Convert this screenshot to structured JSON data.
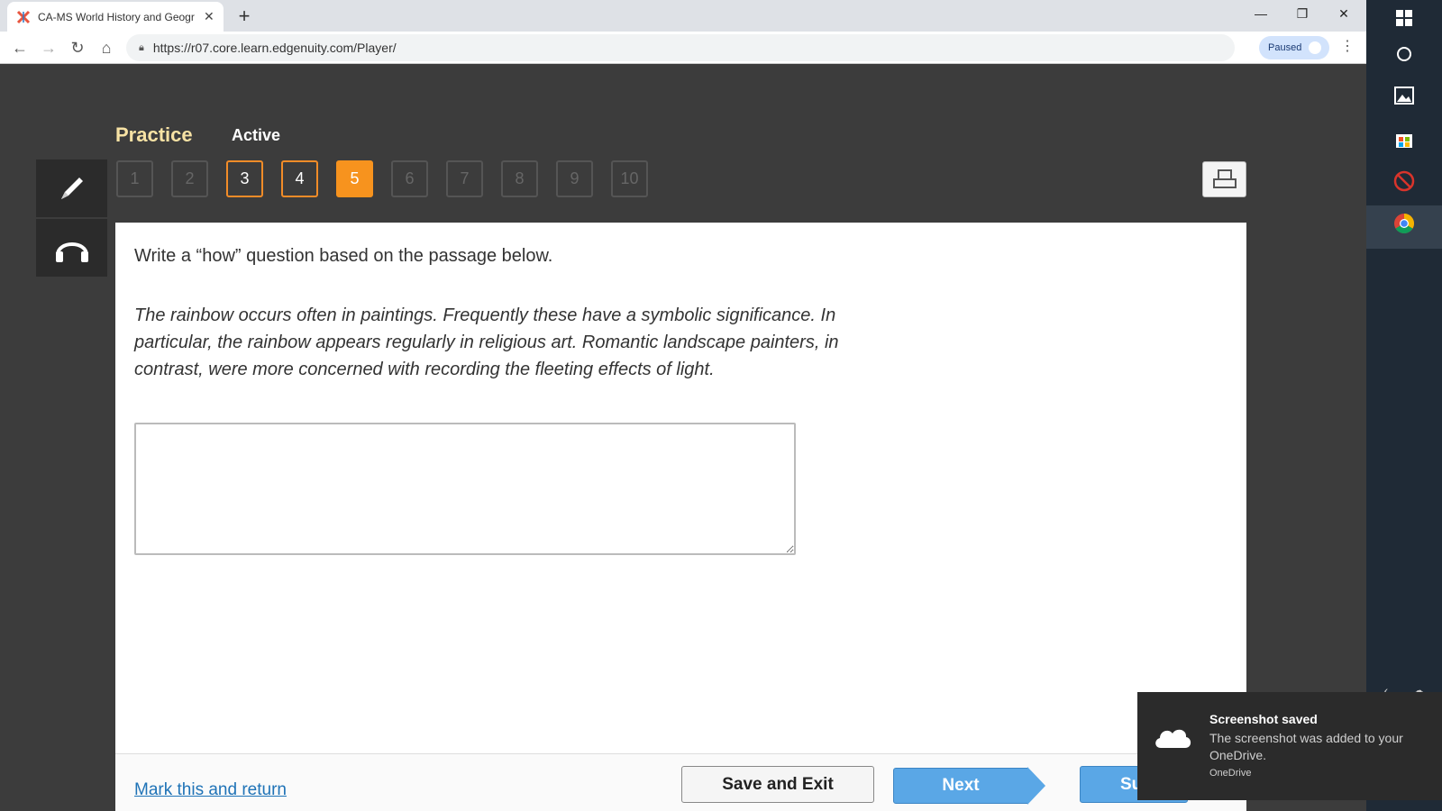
{
  "browser": {
    "tab_title": "CA-MS World History and Geogr",
    "url": "https://r07.core.learn.edgenuity.com/Player/",
    "profile_status": "Paused"
  },
  "player": {
    "section_label": "Practice",
    "status_label": "Active",
    "question_numbers": [
      "1",
      "2",
      "3",
      "4",
      "5",
      "6",
      "7",
      "8",
      "9",
      "10"
    ],
    "current_question": "5",
    "completed_questions": [
      "3",
      "4"
    ]
  },
  "question": {
    "prompt": "Write a “how” question based on the passage below.",
    "passage": "The rainbow occurs often in paintings. Frequently these have a symbolic significance. In particular, the rainbow appears regularly in religious art. Romantic landscape painters, in contrast, were more concerned with recording the fleeting effects of light.",
    "answer_value": ""
  },
  "footer": {
    "mark_link": "Mark this and return",
    "save_exit": "Save and Exit",
    "next": "Next",
    "submit": "Su"
  },
  "toast": {
    "title": "Screenshot saved",
    "body": "The screenshot was added to your OneDrive.",
    "source": "OneDrive"
  },
  "colors": {
    "accent_orange": "#f7931e",
    "button_blue": "#5aa7e6",
    "practice_yellow": "#f7e2a4"
  }
}
